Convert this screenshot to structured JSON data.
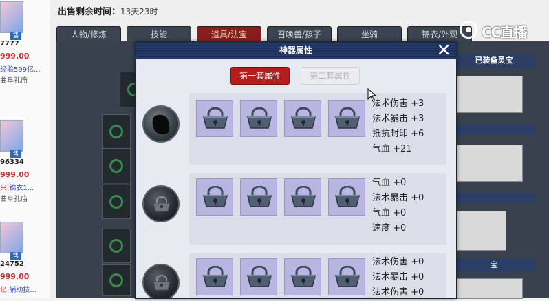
{
  "left_list": [
    {
      "code": "7777",
      "price": "999.00",
      "extra": "经验599亿...",
      "temple": "曲阜孔庙",
      "sell": "售"
    },
    {
      "code": "96334",
      "price": "999.00",
      "extra_red": "只|",
      "extra": "锦衣1...",
      "temple": "曲阜孔庙",
      "sell": "售"
    },
    {
      "code": "24752",
      "price": "999.00",
      "extra_red": "亿|",
      "extra": "辅助技...",
      "temple": "",
      "sell": "售"
    }
  ],
  "header": {
    "sale_time_label": "出售剩余时间：",
    "sale_time_value": "13天23时"
  },
  "tabs": [
    {
      "label": "人物/修炼"
    },
    {
      "label": "技能"
    },
    {
      "label": "道具/法宝",
      "active": true
    },
    {
      "label": "召唤兽/孩子"
    },
    {
      "label": "坐骑"
    },
    {
      "label": "锦衣/外观"
    }
  ],
  "side_panel": {
    "equipped_title": "已装备灵宝",
    "bottom_title": "宝"
  },
  "logo": {
    "text": "CC直播"
  },
  "modal": {
    "title": "神器属性",
    "close_icon": "close-icon",
    "set_tabs": [
      {
        "label": "第一套属性",
        "active": true
      },
      {
        "label": "第二套属性",
        "active": false
      }
    ],
    "rows": [
      {
        "orb": "filled",
        "stats": [
          "法术伤害 +3",
          "法术暴击 +3",
          "抵抗封印 +6",
          "气血 +21"
        ]
      },
      {
        "orb": "locked",
        "stats": [
          "气血 +0",
          "法术暴击 +0",
          "气血 +0",
          "速度 +0"
        ]
      },
      {
        "orb": "locked",
        "stats": [
          "法术伤害 +0",
          "法术暴击 +0",
          "法术伤害 +0"
        ]
      }
    ]
  },
  "colors": {
    "accent_red": "#b81d1d",
    "price_red": "#d42a2a",
    "slot_lavender": "#b8b6e0",
    "title_navy": "#233a6a"
  }
}
